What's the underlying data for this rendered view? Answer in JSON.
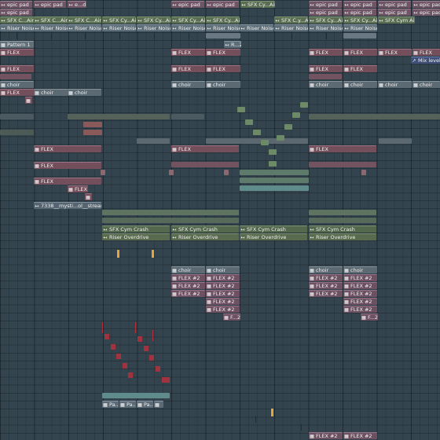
{
  "clip_labels": {
    "epic_pad": "epic pad",
    "epic_pad_e": "e...d",
    "sfx_airy": "SFX C...Airy",
    "sfx_cy_airy": "SFX Cy...Airy",
    "sfx_cyc_airy": "SFX C.y...Airy",
    "sfx_cym_airy": "SFX Cym Airy",
    "riser_noise": "Riser Noise",
    "pattern_1": "Pattern 1",
    "r2": "R...2",
    "flex": "FLEX",
    "choir": "choir",
    "mix_level": "Mix level",
    "stream": "7338__mysti...ol__stream2",
    "sfx_cym_crash": "SFX Cym Crash",
    "riser_overdrive": "Riser Overdrive",
    "flex2": "FLEX #2",
    "f2": "F...2",
    "pa": "Pa..."
  },
  "icons": {
    "pattern": "pattern-icon",
    "audio": "audio-wave-icon",
    "automation": "automation-icon"
  },
  "colors": {
    "background": "#34444f",
    "pad_clip": "#6f5566",
    "sfx_clip": "#5a6e52",
    "riser_clip": "#5d6e78",
    "flex_clip": "#734f5b",
    "crash_clip": "#53684d",
    "note_red": "#a1333f",
    "marker_orange": "#e7a43a"
  }
}
